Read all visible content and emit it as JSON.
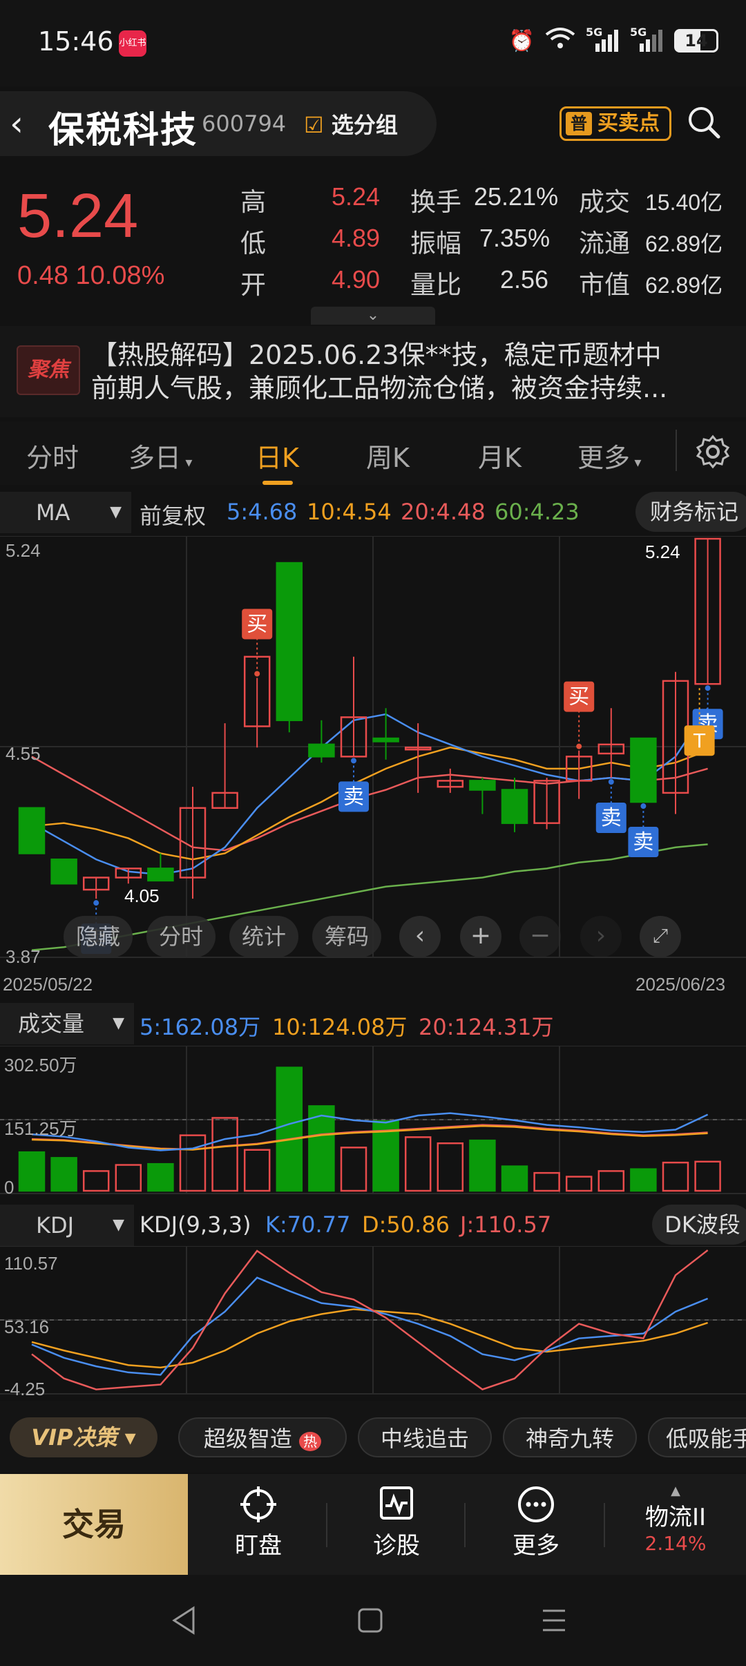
{
  "status": {
    "time": "15:46",
    "app_badge": "小红书",
    "battery": "14",
    "net1": "5G",
    "net2": "5G"
  },
  "header": {
    "stock_name": "保税科技",
    "stock_code": "600794",
    "group_label": "选分组",
    "bs_icon": "普",
    "bs_label": "买卖点"
  },
  "quote": {
    "price": "5.24",
    "change": "0.48 10.08%",
    "rows": [
      {
        "l1": "高",
        "v1": "5.24",
        "l2": "换手",
        "v2": "25.21%",
        "l3": "成交",
        "v3": "15.40亿"
      },
      {
        "l1": "低",
        "v1": "4.89",
        "l2": "振幅",
        "v2": "7.35%",
        "l3": "流通",
        "v3": "62.89亿"
      },
      {
        "l1": "开",
        "v1": "4.90",
        "l2": "量比",
        "v2": "2.56",
        "l3": "市值",
        "v3": "62.89亿"
      }
    ]
  },
  "news": {
    "badge": "聚焦",
    "line1": "【热股解码】2025.06.23保**技，稳定币题材中",
    "line2": "前期人气股，兼顾化工品物流仓储，被资金持续..."
  },
  "tabs": [
    "分时",
    "多日",
    "日K",
    "周K",
    "月K",
    "更多"
  ],
  "active_tab": "日K",
  "ma_bar": {
    "select": "MA",
    "adj": "前复权",
    "ma5": "5:4.68",
    "ma10": "10:4.54",
    "ma20": "20:4.48",
    "ma60": "60:4.23",
    "right_btn": "财务标记"
  },
  "kline_axis": {
    "top": "5.24",
    "mid": "4.55",
    "bottom": "3.87",
    "date_start": "2025/05/22",
    "date_end": "2025/06/23",
    "hi_label": "5.24",
    "lo_label": "4.05"
  },
  "chart_tools": [
    "隐藏",
    "分时",
    "统计",
    "筹码"
  ],
  "signals": {
    "buy": "买",
    "sell": "卖",
    "t": "T"
  },
  "volume_bar": {
    "select": "成交量",
    "ma5": "5:162.08万",
    "ma10": "10:124.08万",
    "ma20": "20:124.31万",
    "top": "302.50万",
    "mid": "151.25万",
    "zero": "0"
  },
  "kdj_bar": {
    "select": "KDJ",
    "params": "KDJ(9,3,3)",
    "k": "K:70.77",
    "d": "D:50.86",
    "j": "J:110.57",
    "right_btn": "DK波段",
    "top": "110.57",
    "mid": "53.16",
    "bottom": "-4.25"
  },
  "strategies": {
    "vip": "VIP决策",
    "items": [
      "超级智造",
      "中线追击",
      "神奇九转",
      "低吸能手"
    ],
    "hot": "热"
  },
  "bottom_nav": {
    "trade": "交易",
    "items": [
      "盯盘",
      "诊股",
      "更多"
    ],
    "sector": "物流II",
    "sector_pct": "2.14%"
  },
  "colors": {
    "up": "#e84b4b",
    "down": "#0a9a0a",
    "ma5": "#4a8ef0",
    "ma10": "#f0a020",
    "ma20": "#e85a5a",
    "ma60": "#6ab04c",
    "accent": "#f0a020"
  },
  "chart_data": {
    "type": "candlestick",
    "dates": [
      "2025/05/22",
      "2025/06/23"
    ],
    "candles": [
      {
        "o": 4.35,
        "h": 4.35,
        "l": 4.2,
        "c": 4.2
      },
      {
        "o": 4.18,
        "h": 4.18,
        "l": 4.1,
        "c": 4.1
      },
      {
        "o": 4.08,
        "h": 4.12,
        "l": 4.05,
        "c": 4.12
      },
      {
        "o": 4.12,
        "h": 4.15,
        "l": 4.1,
        "c": 4.15
      },
      {
        "o": 4.15,
        "h": 4.2,
        "l": 4.11,
        "c": 4.11
      },
      {
        "o": 4.12,
        "h": 4.42,
        "l": 4.05,
        "c": 4.35
      },
      {
        "o": 4.35,
        "h": 4.63,
        "l": 4.35,
        "c": 4.4
      },
      {
        "o": 4.62,
        "h": 4.78,
        "l": 4.55,
        "c": 4.85
      },
      {
        "o": 5.16,
        "h": 5.16,
        "l": 4.6,
        "c": 4.64
      },
      {
        "o": 4.56,
        "h": 4.64,
        "l": 4.5,
        "c": 4.52
      },
      {
        "o": 4.52,
        "h": 4.85,
        "l": 4.52,
        "c": 4.65
      },
      {
        "o": 4.58,
        "h": 4.68,
        "l": 4.51,
        "c": 4.57
      },
      {
        "o": 4.55,
        "h": 4.63,
        "l": 4.4,
        "c": 4.55
      },
      {
        "o": 4.42,
        "h": 4.48,
        "l": 4.4,
        "c": 4.44
      },
      {
        "o": 4.44,
        "h": 4.45,
        "l": 4.33,
        "c": 4.41
      },
      {
        "o": 4.41,
        "h": 4.45,
        "l": 4.27,
        "c": 4.3
      },
      {
        "o": 4.3,
        "h": 4.45,
        "l": 4.28,
        "c": 4.44
      },
      {
        "o": 4.44,
        "h": 4.54,
        "l": 4.38,
        "c": 4.52
      },
      {
        "o": 4.53,
        "h": 4.68,
        "l": 4.45,
        "c": 4.56
      },
      {
        "o": 4.58,
        "h": 4.58,
        "l": 4.37,
        "c": 4.37
      },
      {
        "o": 4.4,
        "h": 4.8,
        "l": 4.33,
        "c": 4.77
      },
      {
        "o": 4.76,
        "h": 5.24,
        "l": 4.76,
        "c": 5.24
      }
    ],
    "ma5": [
      4.3,
      4.24,
      4.18,
      4.14,
      4.13,
      4.15,
      4.22,
      4.35,
      4.45,
      4.55,
      4.64,
      4.66,
      4.6,
      4.56,
      4.52,
      4.49,
      4.46,
      4.44,
      4.45,
      4.44,
      4.52,
      4.68
    ],
    "ma10": [
      4.29,
      4.3,
      4.28,
      4.25,
      4.2,
      4.18,
      4.2,
      4.26,
      4.32,
      4.37,
      4.43,
      4.48,
      4.52,
      4.55,
      4.53,
      4.51,
      4.48,
      4.48,
      4.5,
      4.48,
      4.5,
      4.54
    ],
    "ma20": [
      4.52,
      4.46,
      4.4,
      4.34,
      4.28,
      4.22,
      4.21,
      4.25,
      4.3,
      4.34,
      4.38,
      4.41,
      4.45,
      4.46,
      4.45,
      4.44,
      4.43,
      4.44,
      4.45,
      4.44,
      4.45,
      4.48
    ],
    "ma60": [
      3.88,
      3.89,
      3.91,
      3.93,
      3.95,
      3.97,
      3.99,
      4.01,
      4.03,
      4.05,
      4.07,
      4.09,
      4.1,
      4.11,
      4.12,
      4.14,
      4.15,
      4.17,
      4.18,
      4.2,
      4.22,
      4.23
    ],
    "volume": [
      82,
      70,
      42,
      55,
      57,
      118,
      155,
      87,
      262,
      180,
      92,
      148,
      114,
      101,
      107,
      52,
      38,
      30,
      42,
      46,
      60,
      62
    ],
    "vol_ma5": [
      120,
      115,
      105,
      92,
      86,
      90,
      110,
      120,
      142,
      160,
      150,
      145,
      160,
      165,
      158,
      150,
      140,
      135,
      128,
      125,
      130,
      162
    ],
    "vol_ma10": [
      110,
      108,
      102,
      96,
      90,
      88,
      95,
      100,
      110,
      120,
      125,
      128,
      132,
      136,
      140,
      138,
      132,
      128,
      122,
      118,
      120,
      124
    ],
    "kdj_k": [
      33,
      22,
      15,
      10,
      8,
      40,
      60,
      88,
      77,
      67,
      64,
      58,
      50,
      40,
      25,
      20,
      28,
      38,
      40,
      42,
      60,
      70.77
    ],
    "kdj_d": [
      35,
      28,
      22,
      16,
      14,
      18,
      28,
      42,
      52,
      58,
      62,
      60,
      58,
      50,
      40,
      30,
      27,
      30,
      33,
      36,
      42,
      50.86
    ],
    "kdj_j": [
      25,
      5,
      -4,
      -2,
      0,
      30,
      75,
      110,
      92,
      76,
      70,
      55,
      35,
      15,
      -4,
      5,
      30,
      50,
      42,
      38,
      90,
      110.57
    ],
    "buy_idx": [
      7,
      17
    ],
    "sell_idx": [
      2,
      10,
      18,
      19,
      21
    ],
    "vol_ylim": [
      0,
      302.5
    ],
    "kdj_ylim": [
      -4.25,
      110.57
    ],
    "ylim": [
      3.87,
      5.24
    ]
  }
}
